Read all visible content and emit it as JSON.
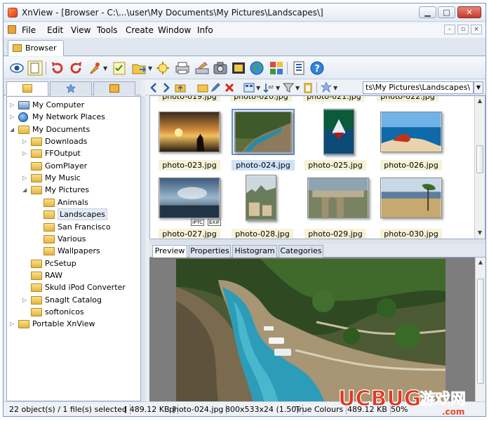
{
  "window": {
    "title": "XnView - [Browser - C:\\...\\user\\My Documents\\My Pictures\\Landscapes\\]",
    "minimize": "▁",
    "maximize": "□",
    "close": "✕"
  },
  "menu": {
    "items": [
      "File",
      "Edit",
      "View",
      "Tools",
      "Create",
      "Window",
      "Info"
    ],
    "mdi_minimize": "–",
    "mdi_restore": "▫",
    "mdi_close": "×"
  },
  "tabs": {
    "browser": "Browser"
  },
  "toolbar": {
    "icons": [
      "eye-icon",
      "page-icon",
      "rotate-left-icon",
      "rotate-right-icon",
      "color-dropper-icon",
      "checklist-icon",
      "open-folder-icon",
      "slideshow-icon",
      "print-icon",
      "scanner-icon",
      "camera-icon",
      "filmstrip-icon",
      "globe-icon",
      "multi-frames-icon",
      "properties-icon",
      "help-icon"
    ]
  },
  "navbar": {
    "path": "ts\\My Pictures\\Landscapes\\"
  },
  "tree": {
    "items": [
      {
        "label": "My Computer",
        "icon": "computer"
      },
      {
        "label": "My Network Places",
        "icon": "network"
      },
      {
        "label": "My Documents",
        "icon": "docs"
      },
      {
        "label": "Downloads",
        "icon": "folder"
      },
      {
        "label": "FFOutput",
        "icon": "folder"
      },
      {
        "label": "GomPlayer",
        "icon": "folder"
      },
      {
        "label": "My Music",
        "icon": "music"
      },
      {
        "label": "My Pictures",
        "icon": "folder"
      },
      {
        "label": "Animals",
        "icon": "folder"
      },
      {
        "label": "Landscapes",
        "icon": "folder",
        "selected": true
      },
      {
        "label": "San Francisco",
        "icon": "folder"
      },
      {
        "label": "Various",
        "icon": "folder"
      },
      {
        "label": "Wallpapers",
        "icon": "folder"
      },
      {
        "label": "PcSetup",
        "icon": "folder"
      },
      {
        "label": "RAW",
        "icon": "folder"
      },
      {
        "label": "Skuld iPod Converter",
        "icon": "folder"
      },
      {
        "label": "SnagIt Catalog",
        "icon": "folder"
      },
      {
        "label": "softonicos",
        "icon": "folder"
      },
      {
        "label": "Portable XnView",
        "icon": "folder"
      }
    ]
  },
  "thumbs": {
    "partial_row": [
      "photo-019.jpg",
      "photo-020.jpg",
      "photo-021.jpg",
      "photo-022.jpg"
    ],
    "files": [
      "photo-023.jpg",
      "photo-024.jpg",
      "photo-025.jpg",
      "photo-026.jpg",
      "photo-027.jpg",
      "photo-028.jpg",
      "photo-029.jpg",
      "photo-030.jpg"
    ],
    "selected": "photo-024.jpg",
    "badge_iptc": "IPTC",
    "badge_exif": "EXIF"
  },
  "info_tabs": [
    "Preview",
    "Properties",
    "Histogram",
    "Categories"
  ],
  "status": {
    "objects": "22 object(s) / 1 file(s) selected",
    "size": "[ 489.12 KB ]",
    "filename": "photo-024.jpg",
    "dimensions": "800x533x24 (1.50)",
    "colors": "True Colours",
    "filesize": "489.12 KB",
    "zoom": "50%"
  },
  "watermark": {
    "brand": "UCBUG",
    "domain": "游戏网",
    "url": ".com"
  }
}
